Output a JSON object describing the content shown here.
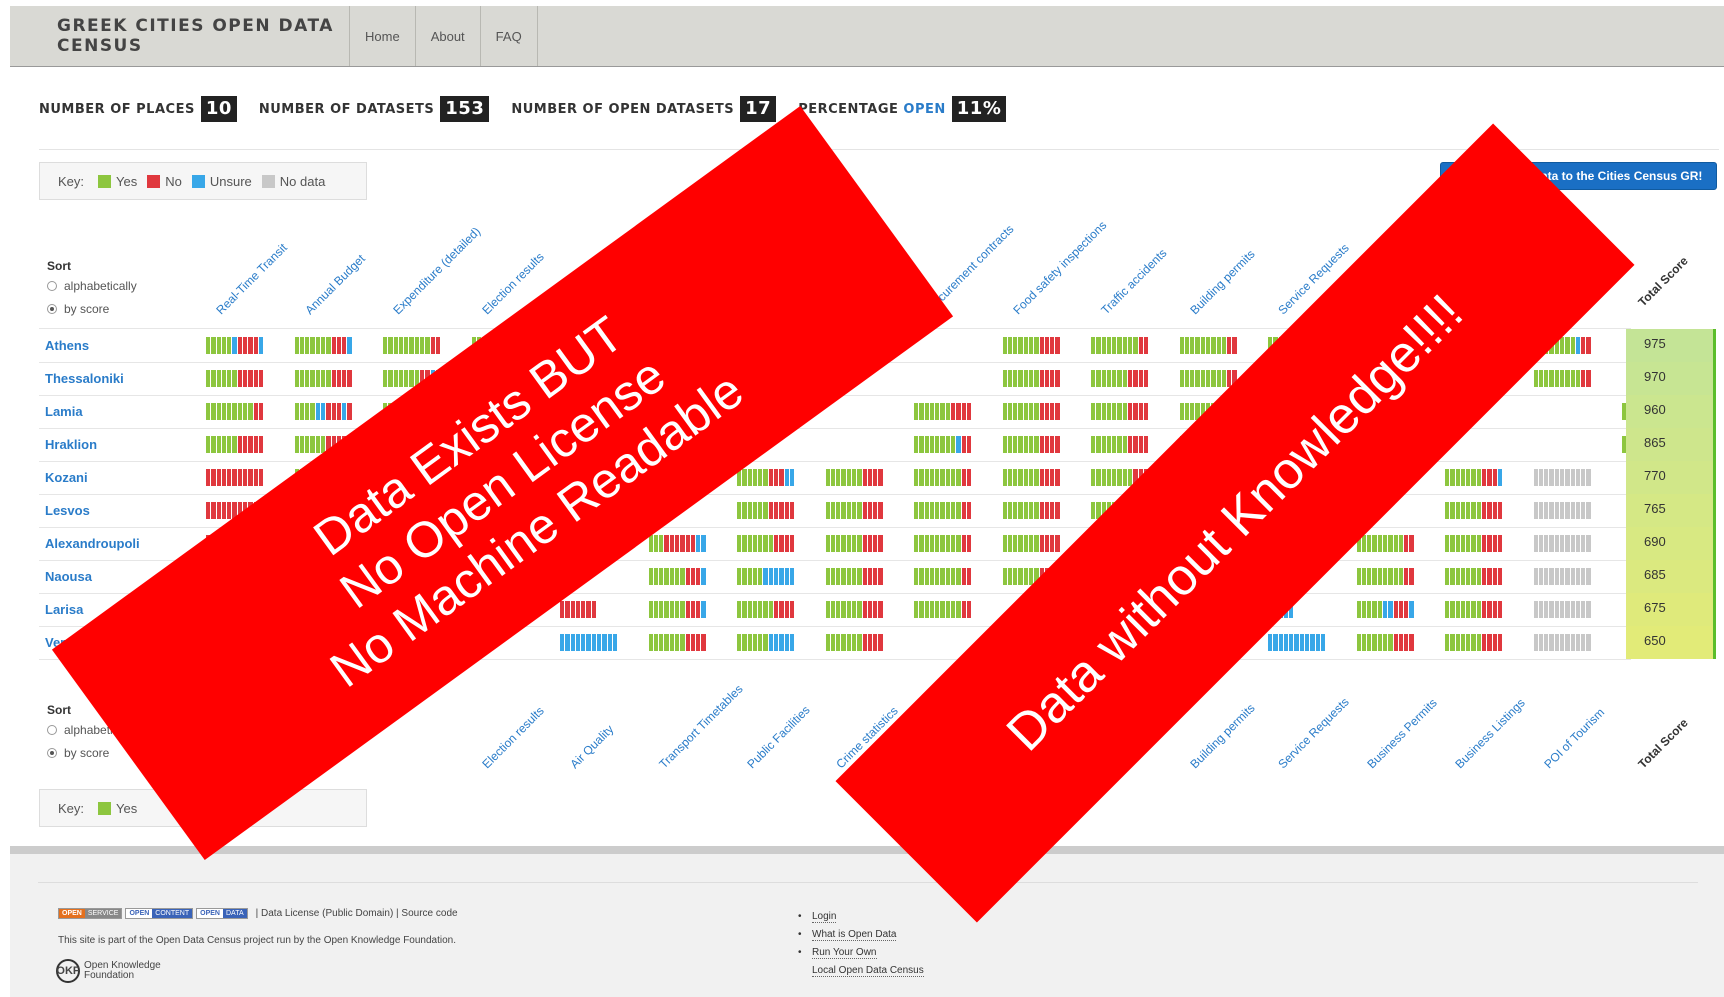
{
  "brand": "GREEK CITIES OPEN DATA CENSUS",
  "nav": [
    "Home",
    "About",
    "FAQ"
  ],
  "stats": {
    "places_label": "NUMBER OF PLACES",
    "places": "10",
    "datasets_label": "NUMBER OF DATASETS",
    "datasets": "153",
    "open_label": "NUMBER OF OPEN DATASETS",
    "open": "17",
    "pct_label": "PERCENTAGE",
    "pct_open_word": "OPEN",
    "pct": "11%"
  },
  "key": {
    "label": "Key:",
    "items": [
      {
        "name": "Yes",
        "color": "#8dc63f"
      },
      {
        "name": "No",
        "color": "#e0383e"
      },
      {
        "name": "Unsure",
        "color": "#38a7e8"
      },
      {
        "name": "No data",
        "color": "#c8c8c8"
      }
    ]
  },
  "contribute_label": "Contribute data to the Cities Census GR!",
  "sort": {
    "title": "Sort",
    "options": [
      "alphabetically",
      "by score"
    ],
    "selected": "by score"
  },
  "columns": [
    "Real-Time Transit",
    "Annual Budget",
    "Expenditure (detailed)",
    "Election results",
    "Air Quality",
    "Transport Timetables",
    "Public Facilities",
    "Crime statistics",
    "Procurement contracts",
    "Food safety inspections",
    "Traffic accidents",
    "Building permits",
    "Service Requests",
    "Business Permits",
    "Business Listings",
    "POI of Tourism"
  ],
  "bottom_columns": [
    "Election results",
    "Air Quality",
    "Transport Timetables",
    "Public Facilities",
    "Crime statistics",
    "Building permits",
    "Service Requests",
    "Business Permits",
    "Business Listings",
    "POI of Tourism",
    "Total Score"
  ],
  "total_score_label": "Total Score",
  "rows": [
    {
      "city": "Athens",
      "score": "975",
      "cells": [
        "GGGGGBRRRRB",
        "GGGGGGGRRRB",
        "GGGGGGGGGRR",
        "GGGGGGGRRRR",
        "",
        "",
        "",
        "",
        "",
        "GGGGGGGRRRR",
        "GGGGGGGGGRR",
        "GGGGGGGGGRR",
        "GGGGGGGGGRR",
        "GGGGGGGRRRB",
        "GGGGGGGRRRB",
        "GGGGGGGGBRR",
        ""
      ]
    },
    {
      "city": "Thessaloniki",
      "score": "970",
      "cells": [
        "GGGGGGRRRRR",
        "GGGGGGGRRRR",
        "GGGGGGGRRBB",
        "GGGGGGGGGRR",
        "",
        "",
        "",
        "",
        "",
        "GGGGGGGRRRR",
        "GGGGGGGRRRR",
        "GGGGGGGGGRR",
        "GGGGGGGGRRR",
        "BBBRRRRRRRR",
        "GGGGGGGGRRR",
        "GGGGGGGGGRR",
        ""
      ]
    },
    {
      "city": "Lamia",
      "score": "960",
      "cells": [
        "GGGGGGGGGRR",
        "GGGGBBRRRBR",
        "GGGGGGGRRRR",
        "",
        "",
        "",
        "",
        "",
        "GGGGGGGRRRR",
        "GGGGGGGRRRR",
        "GGGGGGGRRRR",
        "GGGGGGGGGRR",
        "GGGGGGGRRRR",
        "GGGGGGGRRRR",
        "",
        "",
        "GGGGGGGBBBR"
      ]
    },
    {
      "city": "Hraklion",
      "score": "865",
      "cells": [
        "GGGGGGRRRRR",
        "GGGGGGRRRRR",
        "GGGGG",
        "",
        "",
        "",
        "",
        "",
        "GGGGGGGGBRR",
        "GGGGGGGRRRR",
        "GGGGGGGRRRR",
        "GGGGGGGGGRR",
        "GGGGGGGRRRR",
        "",
        "",
        "",
        "GGGGGGGGGRR"
      ]
    },
    {
      "city": "Kozani",
      "score": "770",
      "cells": [
        "RRRRRRRRRRR",
        "GGGGGGRRRRR",
        "",
        "",
        "",
        "",
        "GGGGGGRRRBB",
        "GGGGGGGRRRR",
        "GGGGGGGGGRR",
        "GGGGGGGRRRR",
        "GGGGGGGGRRR",
        "",
        "",
        "",
        "GGGGGGGRRRB",
        "NNNNNNNNNNN",
        ""
      ]
    },
    {
      "city": "Lesvos",
      "score": "765",
      "cells": [
        "RRRRRRRRRRR",
        "GGGGGG",
        "",
        "",
        "",
        "",
        "GGGGGGRRRRR",
        "GGGGGGGRRRR",
        "GGGGGGGGGRR",
        "GGGGGGGRRRR",
        "GGGGGGGGRRR",
        "",
        "",
        "",
        "GGGGGGGRRRR",
        "NNNNNNNNNNN",
        ""
      ]
    },
    {
      "city": "Alexandroupoli",
      "score": "690",
      "cells": [
        "RRRRRRRRRRR",
        "",
        "",
        "",
        "",
        "GGGRRRRRRBB",
        "GGGGGGGRRRR",
        "GGGGGGGRRRR",
        "GGGGGGGGGRR",
        "GGGGGGGRRRR",
        "",
        "",
        "",
        "GGGGGGGGGRR",
        "GGGGGGGRRRR",
        "NNNNNNNNNNN",
        ""
      ]
    },
    {
      "city": "Naousa",
      "score": "685",
      "cells": [
        "RRRRRR",
        "",
        "",
        "",
        "",
        "GGGGGGGRRRB",
        "GGGGGBBBBBB",
        "GGGGGGGRRRR",
        "GGGGGGGGGRR",
        "GGGGGGGRRRR",
        "",
        "",
        "",
        "GGGGGGGGGRR",
        "GGGGGGGRRRR",
        "NNNNNNNNNNN",
        ""
      ]
    },
    {
      "city": "Larisa",
      "score": "675",
      "cells": [
        "",
        "",
        "",
        "",
        "RRRRRRR",
        "GGGGGGGRRRB",
        "GGGGGGGRRRR",
        "GGGGGGGRRRR",
        "GGGGGGGGGRR",
        "",
        "",
        "",
        "BBBBB",
        "GGGGGBBRRRB",
        "GGGGGGGRRRR",
        "NNNNNNNNNNN",
        ""
      ]
    },
    {
      "city": "Veroia",
      "score": "650",
      "cells": [
        "",
        "",
        "",
        "",
        "BBBBBBBBBBB",
        "GGGGGGGRRRR",
        "GGGGGGBBBBB",
        "GGGGGGGRRRR",
        "",
        "",
        "",
        "",
        "BBBBBBBBBBB",
        "GGGGGGGRRRR",
        "GGGGGGGRRRR",
        "NNNNNNNNNNN",
        ""
      ]
    }
  ],
  "footer": {
    "badges": [
      {
        "a": "OPEN",
        "b": "SERVICE"
      },
      {
        "a": "OPEN",
        "b": "CONTENT"
      },
      {
        "a": "OPEN",
        "b": "DATA"
      }
    ],
    "license_text": "| Data License (Public Domain) | Source code",
    "site_text": "This site is part of the Open Data Census project run by the Open Knowledge Foundation.",
    "okf_logo": "OKF",
    "okf_line1": "Open Knowledge",
    "okf_line2": "Foundation",
    "links": [
      "Login",
      "What is Open Data",
      "Run Your Own",
      "Local Open Data Census"
    ]
  },
  "banner1_lines": [
    "Data Exists BUT",
    "No Open License",
    "No Machine Readable"
  ],
  "banner2_text": "Data without Knowledge!!!!",
  "colors": {
    "yes": "#8dc63f",
    "no": "#e0383e",
    "unsure": "#38a7e8",
    "nodata": "#c8c8c8",
    "accent": "#2a7cc9",
    "banner": "#ff0000"
  }
}
